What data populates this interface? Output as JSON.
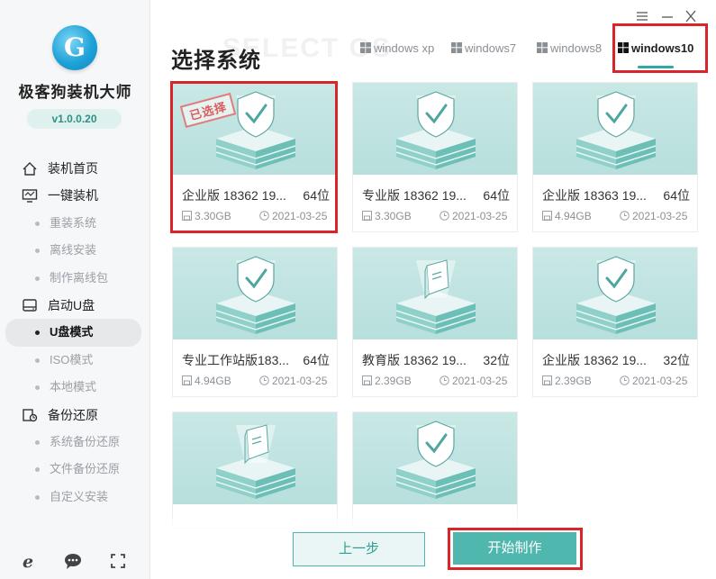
{
  "app": {
    "name": "极客狗装机大师",
    "version": "v1.0.0.20"
  },
  "nav": [
    {
      "type": "main",
      "label": "装机首页",
      "icon": "home-icon"
    },
    {
      "type": "main",
      "label": "一键装机",
      "icon": "monitor-icon"
    },
    {
      "type": "sub",
      "label": "重装系统"
    },
    {
      "type": "sub",
      "label": "离线安装"
    },
    {
      "type": "sub",
      "label": "制作离线包"
    },
    {
      "type": "main",
      "label": "启动U盘",
      "icon": "usb-drive-icon"
    },
    {
      "type": "sub",
      "label": "U盘模式",
      "active": true
    },
    {
      "type": "sub",
      "label": "ISO模式"
    },
    {
      "type": "sub",
      "label": "本地模式"
    },
    {
      "type": "main",
      "label": "备份还原",
      "icon": "backup-icon"
    },
    {
      "type": "sub",
      "label": "系统备份还原"
    },
    {
      "type": "sub",
      "label": "文件备份还原"
    },
    {
      "type": "sub",
      "label": "自定义安装"
    }
  ],
  "header": {
    "title": "选择系统",
    "title_shadow": "SELECT OS"
  },
  "tabs": [
    {
      "label": "windows xp"
    },
    {
      "label": "windows7"
    },
    {
      "label": "windows8"
    },
    {
      "label": "windows10",
      "active": true
    }
  ],
  "cards": [
    {
      "name": "企业版 18362 19...",
      "bits": "64位",
      "size": "3.30GB",
      "date": "2021-03-25",
      "selected": true,
      "stamp": "已选择",
      "thumb_icon": "shield-check-icon"
    },
    {
      "name": "专业版 18362 19...",
      "bits": "64位",
      "size": "3.30GB",
      "date": "2021-03-25",
      "thumb_icon": "shield-check-icon"
    },
    {
      "name": "企业版 18363 19...",
      "bits": "64位",
      "size": "4.94GB",
      "date": "2021-03-25",
      "thumb_icon": "shield-check-icon"
    },
    {
      "name": "专业工作站版183...",
      "bits": "64位",
      "size": "4.94GB",
      "date": "2021-03-25",
      "thumb_icon": "shield-check-icon"
    },
    {
      "name": "教育版 18362 19...",
      "bits": "32位",
      "size": "2.39GB",
      "date": "2021-03-25",
      "thumb_icon": "book-icon"
    },
    {
      "name": "企业版 18362 19...",
      "bits": "32位",
      "size": "2.39GB",
      "date": "2021-03-25",
      "thumb_icon": "shield-check-icon"
    },
    {
      "thumb_icon": "book-icon"
    },
    {
      "thumb_icon": "shield-check-icon"
    }
  ],
  "buttons": {
    "prev": "上一步",
    "start": "开始制作"
  },
  "colors": {
    "accent": "#4fb7ae",
    "highlight": "#d9252a"
  }
}
